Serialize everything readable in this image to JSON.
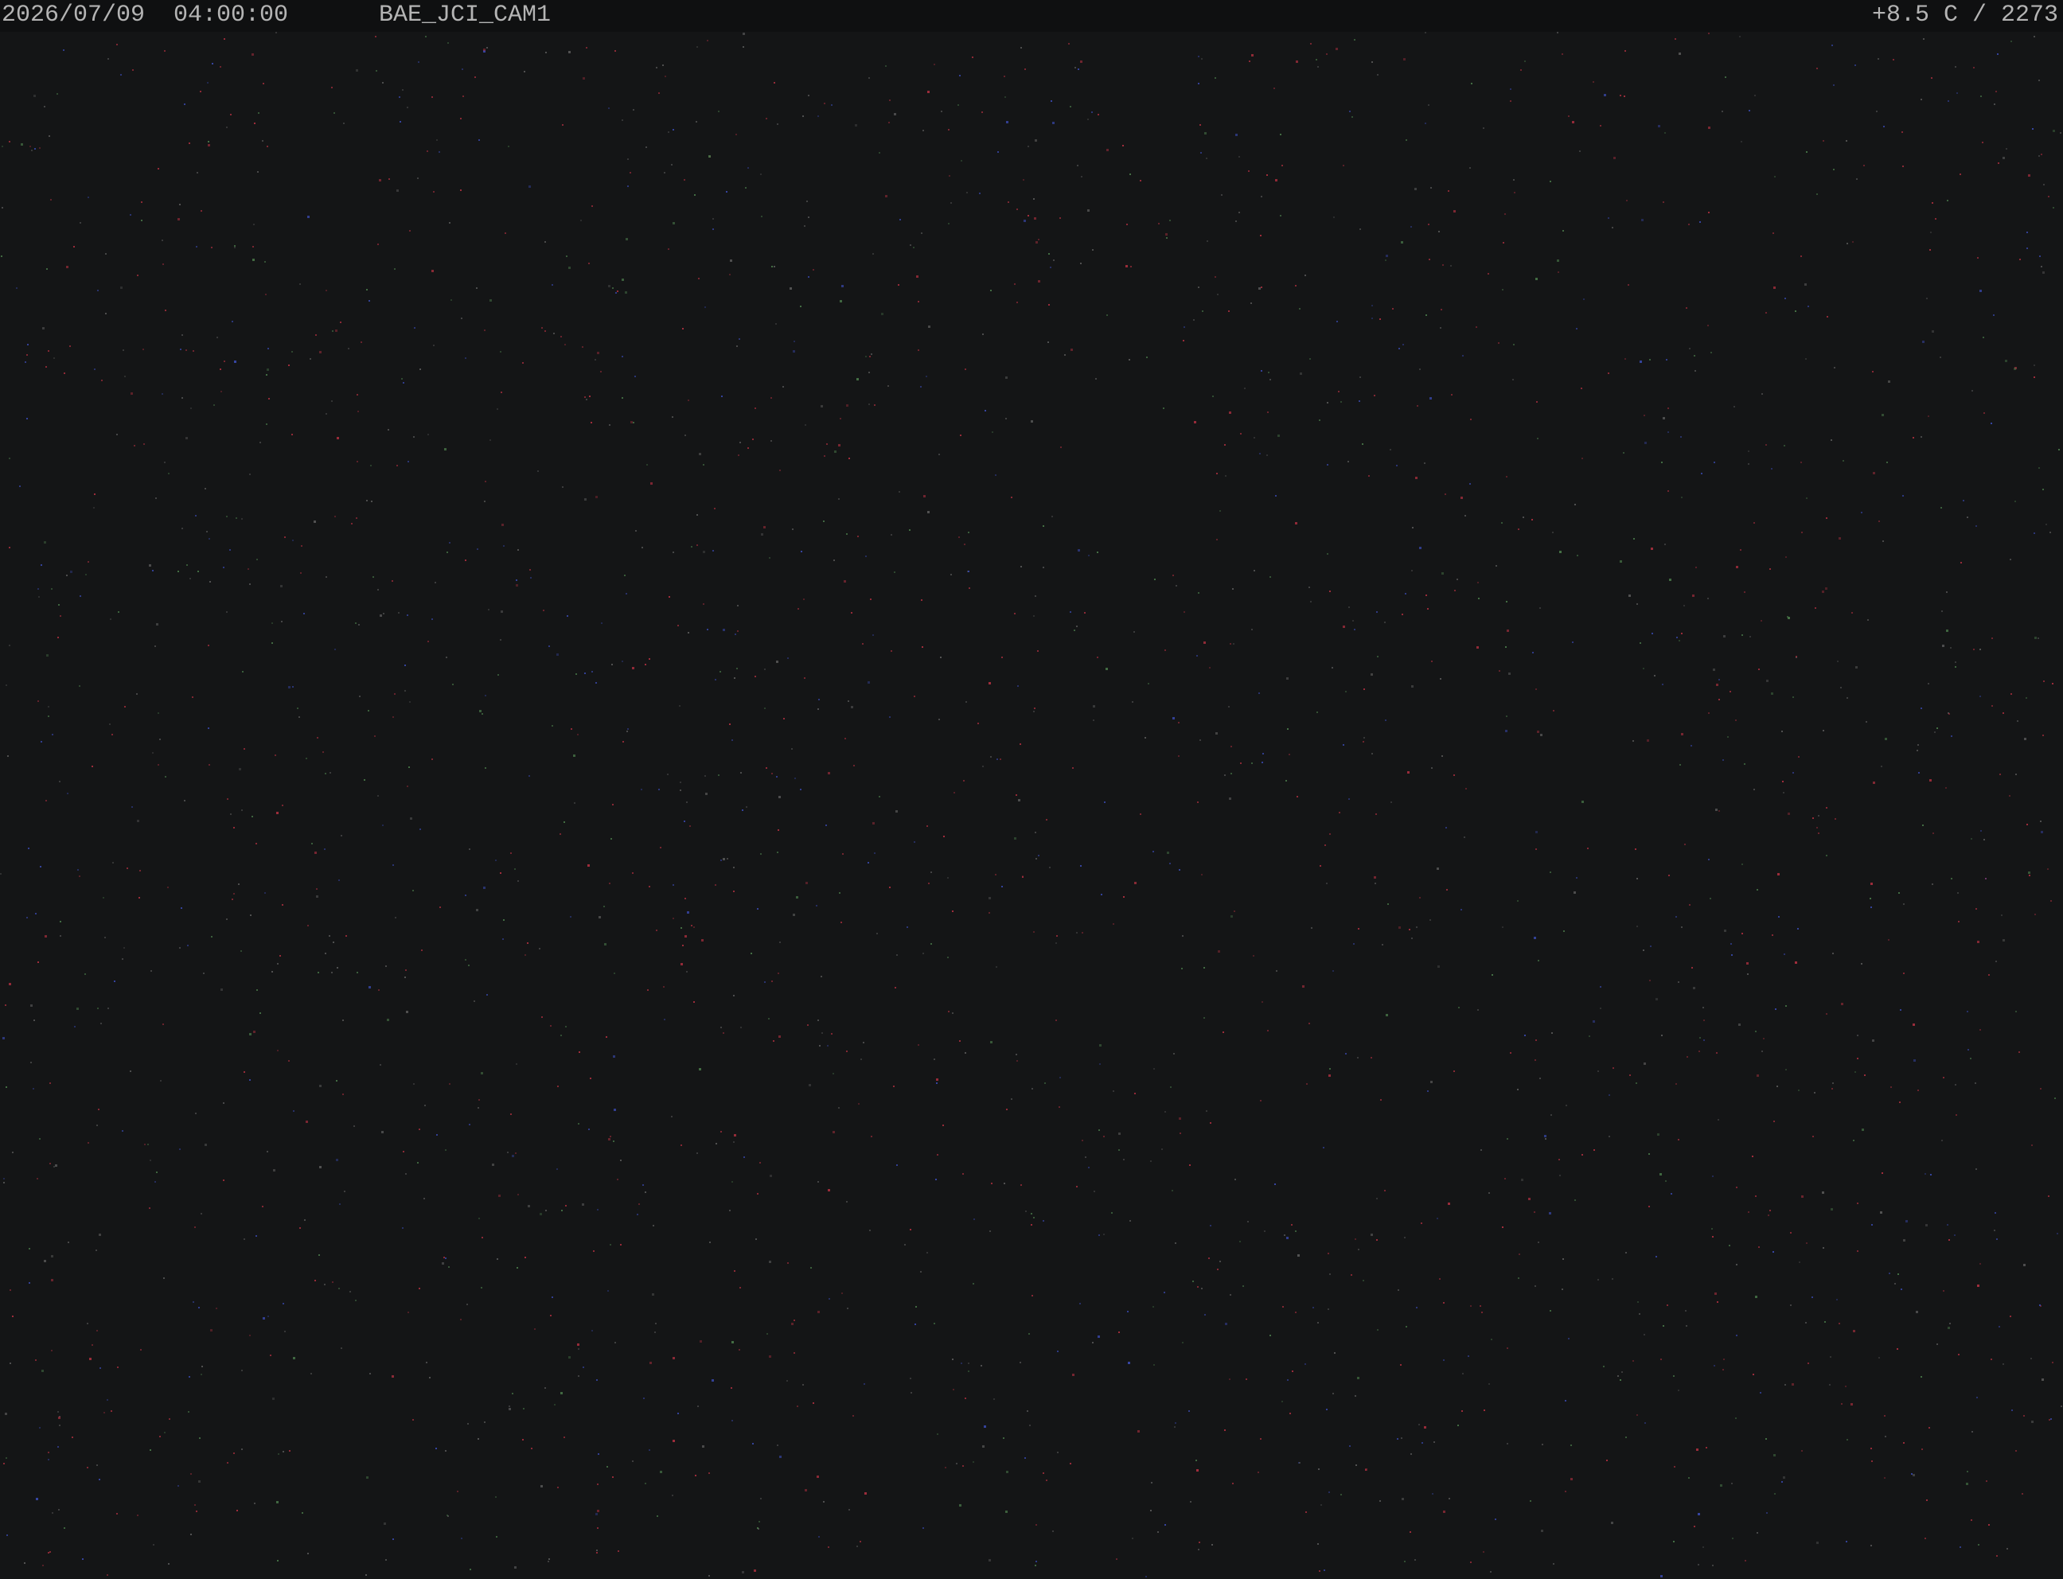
{
  "overlay": {
    "datetime": "2026/07/09  04:00:00",
    "camera_id": "BAE_JCI_CAM1",
    "sensor_readout": "+8.5 C / 2273"
  },
  "colors": {
    "background": "#141516",
    "overlay_bar": "#0f1011",
    "overlay_text": "#b4b4b4",
    "noise_red": "#b03040",
    "noise_green": "#4a7a4a",
    "noise_blue": "#3a4ab0",
    "noise_gray": "#5a5a5a"
  }
}
